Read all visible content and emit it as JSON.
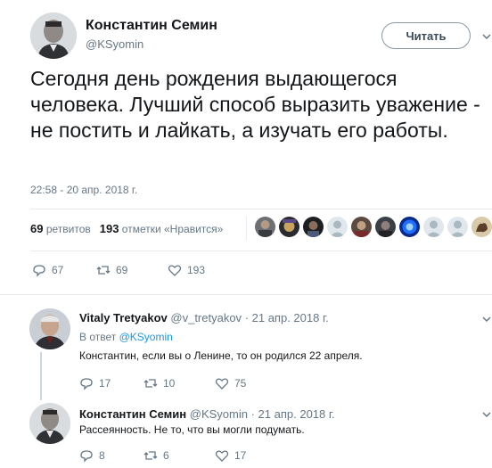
{
  "tweet": {
    "author_name": "Константин Семин",
    "author_handle": "@KSyomin",
    "follow_label": "Читать",
    "text": "Сегодня день рождения выдающегося человека. Лучший способ выразить уважение - не постить и лайкать, а изучать его работы.",
    "timestamp": "22:58 - 20 апр. 2018 г.",
    "retweets_count": "69",
    "retweets_label": "ретвитов",
    "likes_count": "193",
    "likes_label": "отметки «Нравится»",
    "actions": {
      "replies": "67",
      "retweets": "69",
      "likes": "193"
    }
  },
  "replies": [
    {
      "author_name": "Vitaly Tretyakov",
      "author_handle": "@v_tretyakov",
      "date": "· 21 апр. 2018 г.",
      "reply_to_prefix": "В ответ",
      "reply_to_handle": "@KSyomin",
      "text": "Константин, если вы о Ленине, то он родился 22 апреля.",
      "actions": {
        "replies": "17",
        "retweets": "10",
        "likes": "75"
      }
    },
    {
      "author_name": "Константин Семин",
      "author_handle": "@KSyomin",
      "date": "· 21 апр. 2018 г.",
      "text": "Рассеянность. Не то, что вы могли подумать.",
      "actions": {
        "replies": "8",
        "retweets": "6",
        "likes": "17"
      }
    }
  ],
  "colors": {
    "link": "#1b95e0",
    "muted": "#657786",
    "text": "#14171a",
    "divider": "#e6ecf0"
  },
  "icons": [
    "reply-icon",
    "retweet-icon",
    "like-icon",
    "caret-down-icon"
  ]
}
